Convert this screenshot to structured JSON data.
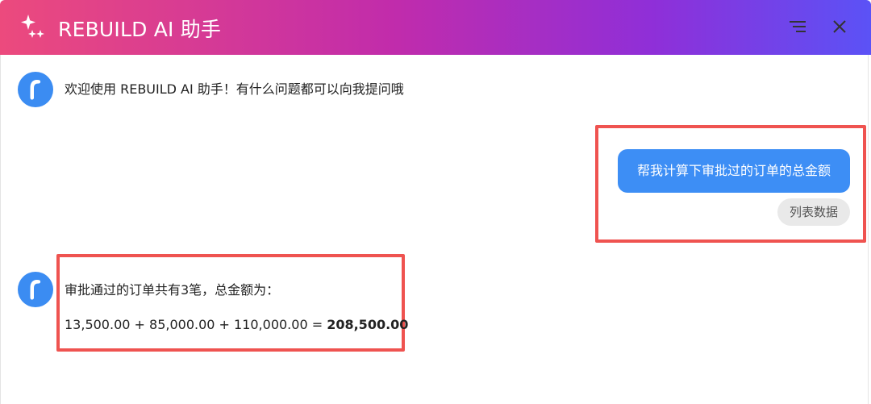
{
  "header": {
    "title": "REBUILD AI 助手",
    "menu_icon": "menu-lines-icon",
    "close_icon": "close-icon",
    "gradient": [
      "#ec4a7d",
      "#c12cab",
      "#8f2fd8",
      "#5b52f6"
    ]
  },
  "messages": {
    "welcome": "欢迎使用 REBUILD AI 助手！有什么问题都可以向我提问哦",
    "user_question": "帮我计算下审批过的订单的总金额",
    "user_chip": "列表数据",
    "answer_line1": "审批通过的订单共有3笔，总金额为：",
    "answer_expr": "13,500.00 + 85,000.00 + 110,000.00 = ",
    "answer_total": "208,500.00"
  },
  "colors": {
    "accent_blue": "#3d8ef5",
    "highlight_red": "#ef5350",
    "chip_bg": "#e9e9e9"
  }
}
